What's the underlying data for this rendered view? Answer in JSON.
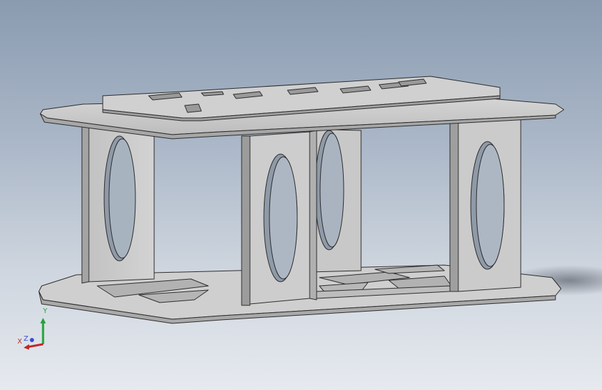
{
  "viewport": {
    "background_top": "#8a9bb0",
    "background_bottom": "#e6eaef"
  },
  "model": {
    "part_color": "#c9c9c9",
    "part_shadow": "#9c9c9c",
    "edge_color": "#2b2b2b"
  },
  "triad": {
    "x_label": "X",
    "y_label": "Y",
    "z_label": "Z",
    "x_color": "#c0282a",
    "y_color": "#22a23a",
    "z_color": "#3a4bd0"
  }
}
